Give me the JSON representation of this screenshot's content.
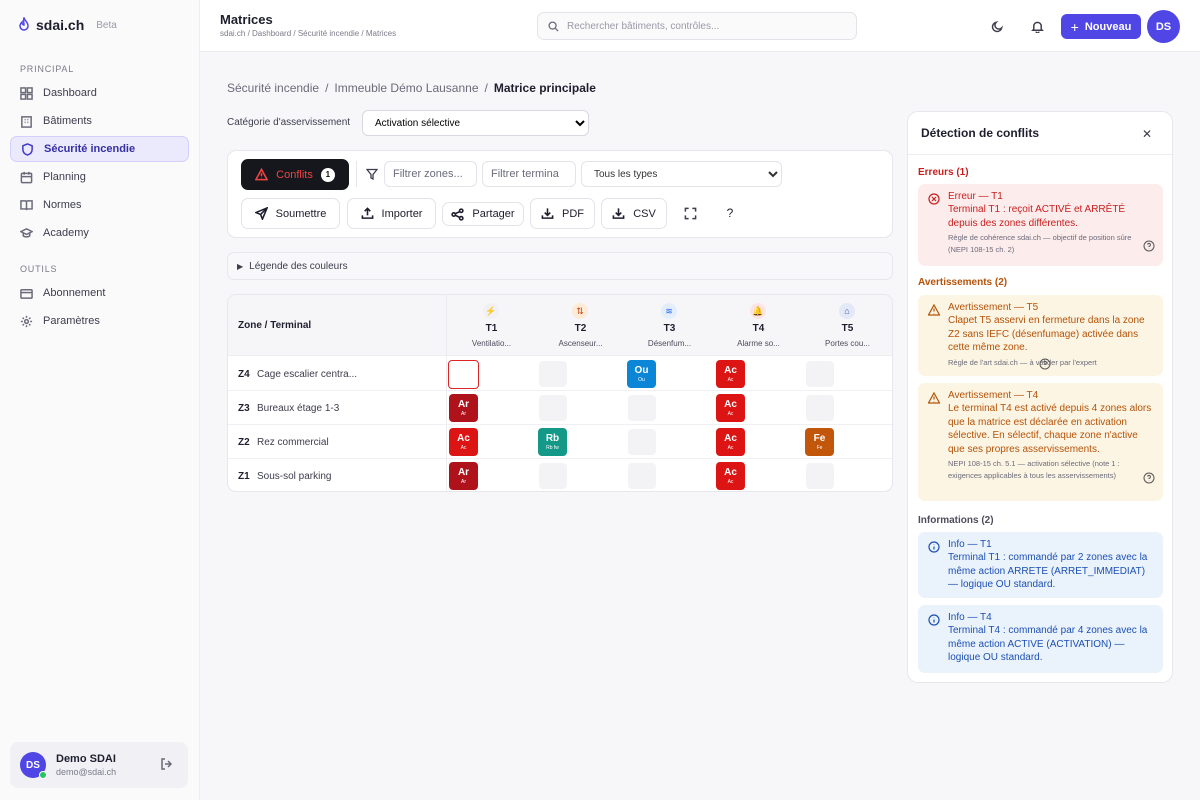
{
  "brand": {
    "name": "sdai.ch",
    "beta": "Beta"
  },
  "sidebar": {
    "section1": "PRINCIPAL",
    "items": [
      {
        "label": "Dashboard"
      },
      {
        "label": "Bâtiments"
      },
      {
        "label": "Sécurité incendie",
        "active": true
      },
      {
        "label": "Planning"
      },
      {
        "label": "Normes"
      },
      {
        "label": "Academy"
      }
    ],
    "section2": "OUTILS",
    "tools": [
      {
        "label": "Abonnement"
      },
      {
        "label": "Paramètres"
      }
    ],
    "user": {
      "initials": "DS",
      "name": "Demo SDAI",
      "email": "demo@sdai.ch"
    }
  },
  "header": {
    "title": "Matrices",
    "breadcrumb": "sdai.ch / Dashboard / Sécurité incendie / Matrices",
    "search_placeholder": "Rechercher bâtiments, contrôles...",
    "new_label": "Nouveau",
    "avatar": "DS"
  },
  "main": {
    "breadcrumb": [
      "Sécurité incendie",
      "Immeuble Démo Lausanne",
      "Matrice principale"
    ],
    "category_label": "Catégorie d'asservissement",
    "category_value": "Activation sélective",
    "toolbar": {
      "conflicts_label": "Conflits",
      "conflicts_count": "1",
      "filter_zones_placeholder": "Filtrer zones...",
      "filter_terminals_placeholder": "Filtrer termina",
      "type_select": "Tous les types",
      "submit": "Soumettre",
      "import": "Importer",
      "share": "Partager",
      "pdf": "PDF",
      "csv": "CSV",
      "help": "?"
    },
    "legend_label": "Légende des couleurs",
    "matrix": {
      "zone_header": "Zone / Terminal",
      "terminals": [
        {
          "code": "T1",
          "desc": "Ventilatio...",
          "icon": "⚡",
          "color": "#f1f1f5",
          "fg": "#333"
        },
        {
          "code": "T2",
          "desc": "Ascenseur...",
          "icon": "⇅",
          "color": "#fdebd8",
          "fg": "#c2410c"
        },
        {
          "code": "T3",
          "desc": "Désenfum...",
          "icon": "≋",
          "color": "#e3eefc",
          "fg": "#2563eb"
        },
        {
          "code": "T4",
          "desc": "Alarme so...",
          "icon": "🔔",
          "color": "#fde4e4",
          "fg": "#dc2626"
        },
        {
          "code": "T5",
          "desc": "Portes cou...",
          "icon": "⌂",
          "color": "#e4e9f7",
          "fg": "#4254a5"
        }
      ],
      "rows": [
        {
          "code": "Z4",
          "name": "Cage escalier centra...",
          "cells": [
            {
              "sel": true
            },
            {},
            {
              "t": "Ou",
              "s": "Ou",
              "c": "#0b86d6"
            },
            {
              "t": "Ac",
              "s": "Ac",
              "c": "#dc1414"
            },
            {}
          ]
        },
        {
          "code": "Z3",
          "name": "Bureaux étage 1-3",
          "cells": [
            {
              "t": "Ar",
              "s": "Ar",
              "c": "#b0121c"
            },
            {},
            {},
            {
              "t": "Ac",
              "s": "Ac",
              "c": "#dc1414"
            },
            {}
          ]
        },
        {
          "code": "Z2",
          "name": "Rez commercial",
          "cells": [
            {
              "t": "Ac",
              "s": "Ac",
              "c": "#dc1414"
            },
            {
              "t": "Rb",
              "s": "Rb fw",
              "c": "#149888"
            },
            {},
            {
              "t": "Ac",
              "s": "Ac",
              "c": "#dc1414"
            },
            {
              "t": "Fe",
              "s": "Fe",
              "c": "#c2570c"
            }
          ]
        },
        {
          "code": "Z1",
          "name": "Sous-sol parking",
          "cells": [
            {
              "t": "Ar",
              "s": "Ar",
              "c": "#b0121c"
            },
            {},
            {},
            {
              "t": "Ac",
              "s": "Ac",
              "c": "#dc1414"
            },
            {}
          ]
        }
      ]
    }
  },
  "panel": {
    "title": "Détection de conflits",
    "close": "✕",
    "errors_header": "Erreurs (1)",
    "error1": {
      "title": "Erreur — T1",
      "body": "Terminal T1 : reçoit ACTIVÉ et ARRÊTÉ depuis des zones différentes.",
      "source": "Règle de cohérence sdai.ch — objectif de position sûre (NEPI 108-15 ch. 2)"
    },
    "warnings_header": "Avertissements (2)",
    "warn1": {
      "title": "Avertissement — T5",
      "body": "Clapet T5 asservi en fermeture dans la zone Z2 sans IEFC (désenfumage) activée dans cette même zone.",
      "source": "Règle de l'art sdai.ch — à valider par l'expert"
    },
    "warn2": {
      "title": "Avertissement — T4",
      "body": "Le terminal T4 est activé depuis 4 zones alors que la matrice est déclarée en activation sélective. En sélectif, chaque zone n'active que ses propres asservissements.",
      "source": "NEPI 108-15 ch. 5.1 — activation sélective (note 1 : exigences applicables à tous les asservissements)"
    },
    "info_header": "Informations (2)",
    "info1": {
      "title": "Info — T1",
      "body": "Terminal T1 : commandé par 2 zones avec la même action ARRETE (ARRET_IMMEDIAT) — logique OU standard."
    },
    "info2": {
      "title": "Info — T4",
      "body": "Terminal T4 : commandé par 4 zones avec la même action ACTIVE (ACTIVATION) — logique OU standard."
    }
  }
}
